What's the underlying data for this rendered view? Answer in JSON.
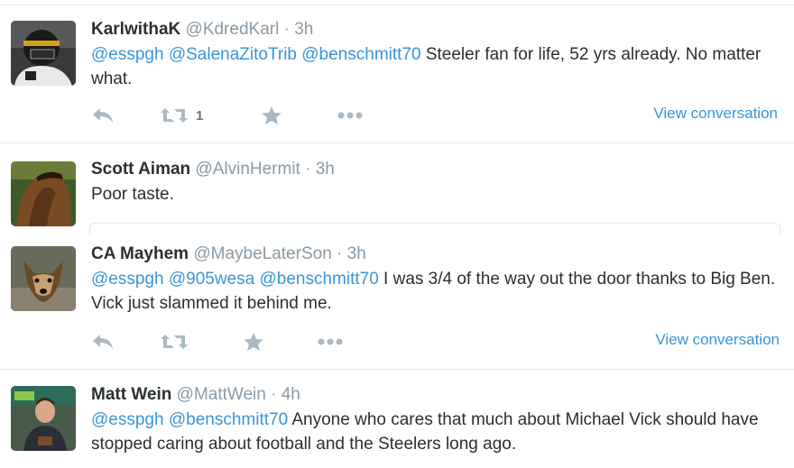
{
  "tweets": [
    {
      "fullname": "KarlwithaK",
      "handle": "@KdredKarl",
      "dot": "·",
      "time": "3h",
      "mentions": [
        "@esspgh",
        "@SalenaZitoTrib",
        "@benschmitt70"
      ],
      "text": "Steeler fan for life, 52 yrs already. No matter what.",
      "retweet_count": "1",
      "view_conversation": "View conversation"
    },
    {
      "fullname": "Scott Aiman",
      "handle": "@AlvinHermit",
      "dot": "·",
      "time": "3h",
      "text": "Poor taste."
    },
    {
      "fullname": "CA Mayhem",
      "handle": "@MaybeLaterSon",
      "dot": "·",
      "time": "3h",
      "mentions": [
        "@esspgh",
        "@905wesa",
        "@benschmitt70"
      ],
      "text": "I was 3/4 of the way out the door thanks to Big Ben. Vick just slammed it behind me.",
      "view_conversation": "View conversation"
    },
    {
      "fullname": "Matt Wein",
      "handle": "@MattWein",
      "dot": "·",
      "time": "4h",
      "mentions": [
        "@esspgh",
        "@benschmitt70"
      ],
      "text": "Anyone who cares that much about Michael Vick should have stopped caring about football and the Steelers long ago."
    }
  ],
  "colors": {
    "link": "#3b94d9",
    "meta": "#8899a6",
    "action_icon": "#aab8c2",
    "divider": "#e1e8ed"
  },
  "icons": [
    "reply-icon",
    "retweet-icon",
    "favorite-icon",
    "more-icon"
  ]
}
